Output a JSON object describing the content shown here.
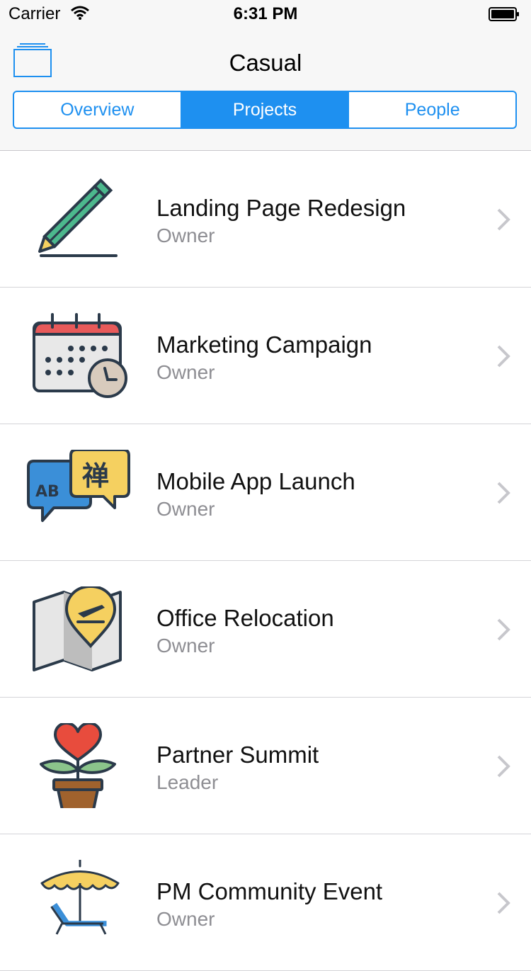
{
  "status_bar": {
    "carrier": "Carrier",
    "time": "6:31 PM"
  },
  "nav": {
    "title": "Casual"
  },
  "tabs": [
    {
      "label": "Overview",
      "active": false
    },
    {
      "label": "Projects",
      "active": true
    },
    {
      "label": "People",
      "active": false
    }
  ],
  "projects": [
    {
      "title": "Landing Page Redesign",
      "role": "Owner",
      "icon": "pencil-icon"
    },
    {
      "title": "Marketing Campaign",
      "role": "Owner",
      "icon": "calendar-clock-icon"
    },
    {
      "title": "Mobile App Launch",
      "role": "Owner",
      "icon": "translate-bubbles-icon"
    },
    {
      "title": "Office Relocation",
      "role": "Owner",
      "icon": "map-pin-plane-icon"
    },
    {
      "title": "Partner Summit",
      "role": "Leader",
      "icon": "heart-plant-icon"
    },
    {
      "title": "PM Community Event",
      "role": "Owner",
      "icon": "beach-umbrella-icon"
    }
  ],
  "colors": {
    "accent": "#1e90f0",
    "secondary_text": "#8e8e93"
  }
}
